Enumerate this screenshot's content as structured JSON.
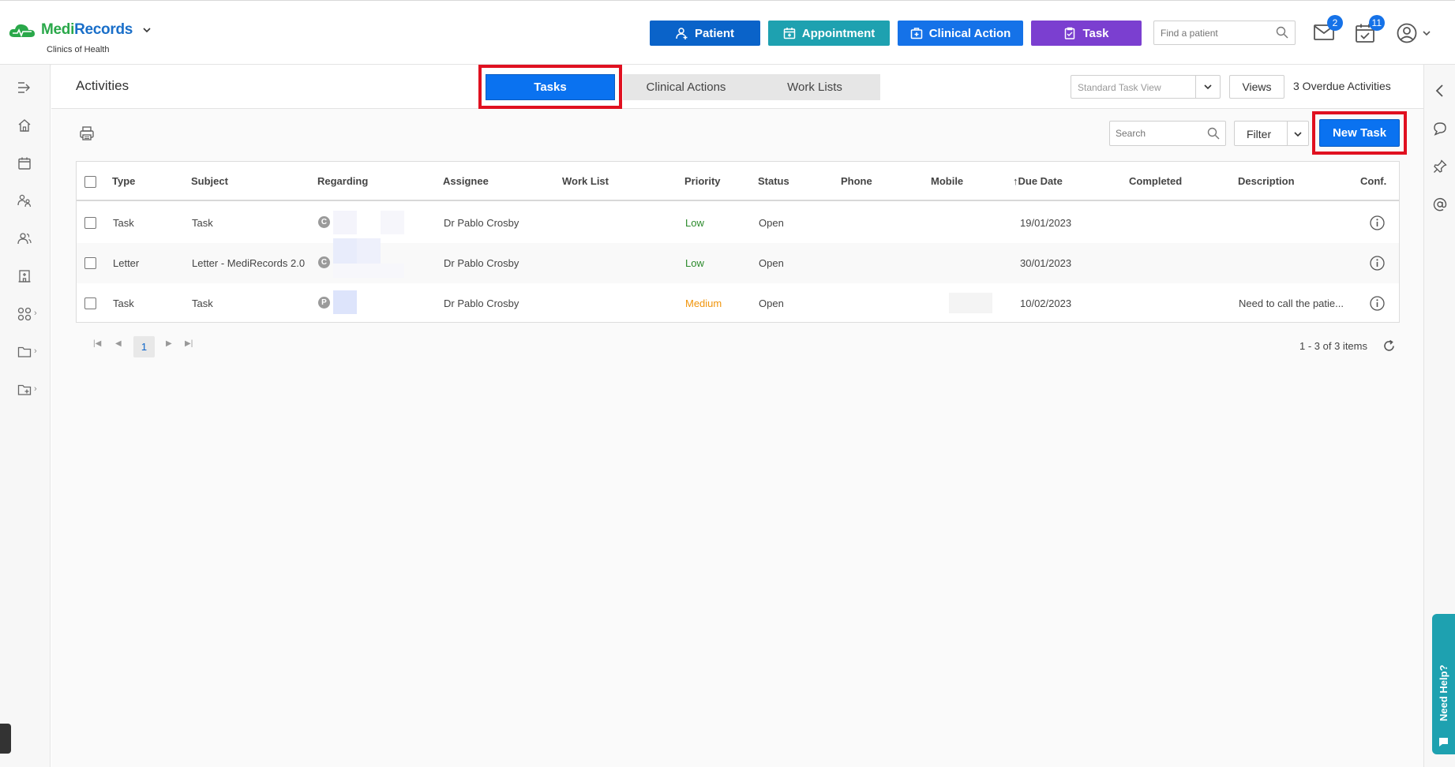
{
  "app": {
    "brand_part1": "Medi",
    "brand_part2": "Records",
    "clinic": "Clinics of Health"
  },
  "topbar": {
    "buttons": {
      "patient": "Patient",
      "appointment": "Appointment",
      "clinical_action": "Clinical Action",
      "task": "Task"
    },
    "find_patient_placeholder": "Find a patient",
    "mail_badge": "2",
    "tasks_badge": "11"
  },
  "page": {
    "title": "Activities",
    "tabs": {
      "tasks": "Tasks",
      "clinical_actions": "Clinical Actions",
      "work_lists": "Work Lists"
    },
    "view_select": "Standard Task View",
    "views_label": "Views",
    "overdue": "3 Overdue Activities"
  },
  "toolbar": {
    "search_placeholder": "Search",
    "filter_label": "Filter",
    "new_task_label": "New Task"
  },
  "table": {
    "columns": {
      "type": "Type",
      "subject": "Subject",
      "regarding": "Regarding",
      "assignee": "Assignee",
      "worklist": "Work List",
      "priority": "Priority",
      "status": "Status",
      "phone": "Phone",
      "mobile": "Mobile",
      "due_date": "Due Date",
      "completed": "Completed",
      "description": "Description",
      "conf": "Conf."
    },
    "rows": [
      {
        "type": "Task",
        "subject": "Task",
        "regarding_badge": "C",
        "assignee": "Dr Pablo Crosby",
        "priority": "Low",
        "status": "Open",
        "due_date": "19/01/2023",
        "description": ""
      },
      {
        "type": "Letter",
        "subject": "Letter - MediRecords 2.0",
        "regarding_badge": "C",
        "assignee": "Dr Pablo Crosby",
        "priority": "Low",
        "status": "Open",
        "due_date": "30/01/2023",
        "description": ""
      },
      {
        "type": "Task",
        "subject": "Task",
        "regarding_badge": "P",
        "assignee": "Dr Pablo Crosby",
        "priority": "Medium",
        "status": "Open",
        "due_date": "10/02/2023",
        "description": "Need to call the patie..."
      }
    ]
  },
  "pager": {
    "current_page": "1",
    "info": "1 - 3 of 3 items"
  },
  "help": {
    "label": "Need Help?"
  },
  "colors": {
    "primary": "#0a72f0",
    "patient": "#0a63c9",
    "appointment": "#1ea1b0",
    "clinical": "#1572e8",
    "task": "#7b3fd0",
    "highlight": "#e01020",
    "low": "#2b8a2b",
    "medium": "#f0940a"
  }
}
